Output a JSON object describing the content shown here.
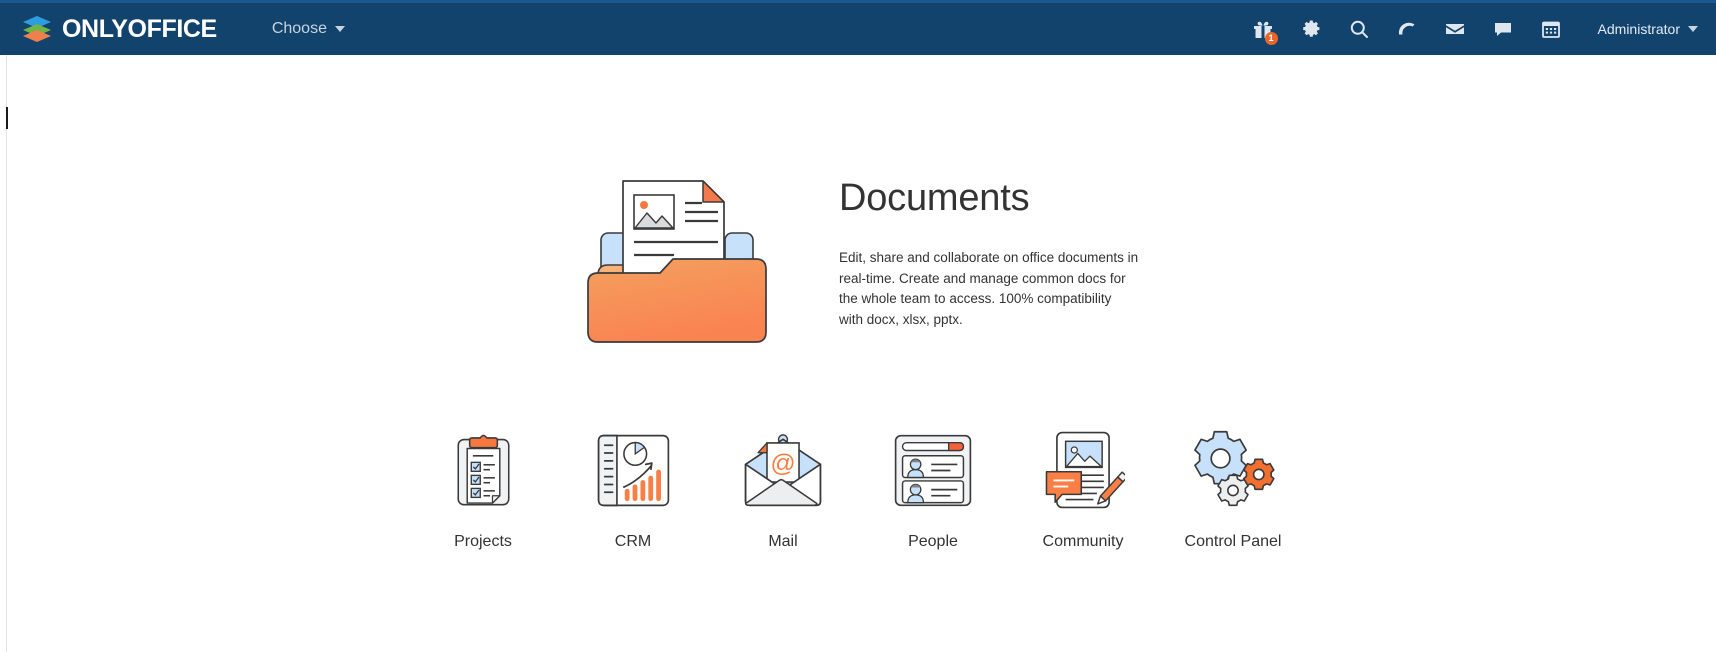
{
  "header": {
    "logo_icon": "onlyoffice-layers-logo",
    "logo_text": "ONLYOFFICE",
    "choose_label": "Choose",
    "caret_icon": "chevron-down-icon",
    "icons": [
      {
        "name": "gift-icon",
        "title": "Gifts",
        "badge": "1"
      },
      {
        "name": "gear-icon",
        "title": "Settings",
        "badge": ""
      },
      {
        "name": "search-icon",
        "title": "Search",
        "badge": ""
      },
      {
        "name": "feed-icon",
        "title": "Feed",
        "badge": ""
      },
      {
        "name": "mail-icon",
        "title": "Mail",
        "badge": ""
      },
      {
        "name": "chat-icon",
        "title": "Talk",
        "badge": ""
      },
      {
        "name": "calendar-icon",
        "title": "Calendar",
        "badge": ""
      }
    ],
    "user_name": "Administrator",
    "bg_color": "#12436d",
    "badge_color": "#e8662a"
  },
  "hero": {
    "illustration": "documents-folder-illustration",
    "title": "Documents",
    "description": "Edit, share and collaborate on office documents in real-time. Create and manage common docs for the whole team to access. 100% compatibility with docx, xlsx, pptx."
  },
  "modules": [
    {
      "label": "Projects",
      "icon": "projects-clipboard-icon"
    },
    {
      "label": "CRM",
      "icon": "crm-chart-icon"
    },
    {
      "label": "Mail",
      "icon": "mail-envelope-icon"
    },
    {
      "label": "People",
      "icon": "people-cards-icon"
    },
    {
      "label": "Community",
      "icon": "community-blog-icon"
    },
    {
      "label": "Control Panel",
      "icon": "control-panel-gears-icon"
    }
  ],
  "theme": {
    "accent_orange": "#f2703a",
    "accent_blue": "#c3dffa",
    "header_blue": "#12436d",
    "text_dark": "#333333"
  }
}
